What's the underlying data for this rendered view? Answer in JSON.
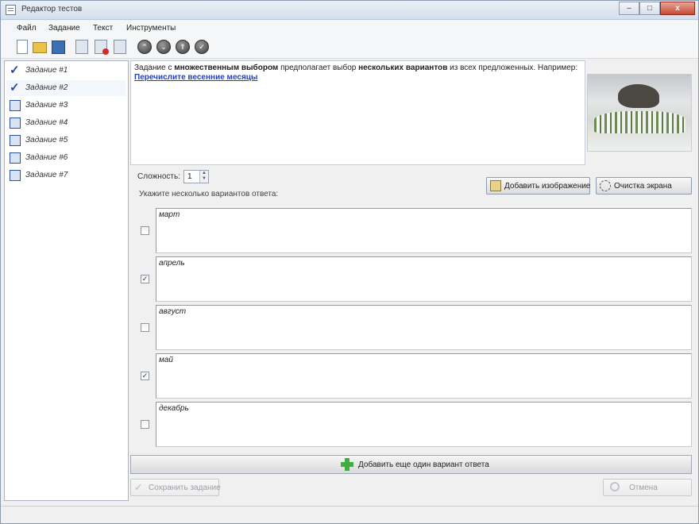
{
  "window": {
    "title": "Редактор тестов",
    "controls": {
      "minimize": "–",
      "maximize": "□",
      "close": "x"
    }
  },
  "menu": [
    "Файл",
    "Задание",
    "Текст",
    "Инструменты"
  ],
  "toolbar": {
    "icons": [
      "new-document-icon",
      "open-folder-icon",
      "save-icon",
      "add-task-icon",
      "delete-task-icon",
      "copy-task-icon",
      "move-up-icon",
      "move-down-icon",
      "move-top-icon",
      "move-bottom-icon"
    ],
    "arrow_up": "⌃",
    "arrow_down": "⌄",
    "arrow_top": "⇑",
    "arrow_check": "✓"
  },
  "tasks": [
    {
      "label": "Задание #1",
      "icon": "check-icon"
    },
    {
      "label": "Задание #2",
      "icon": "check-icon"
    },
    {
      "label": "Задание #3",
      "icon": "ordering-icon"
    },
    {
      "label": "Задание #4",
      "icon": "matching-icon"
    },
    {
      "label": "Задание #5",
      "icon": "input-icon"
    },
    {
      "label": "Задание #6",
      "icon": "text-input-icon"
    },
    {
      "label": "Задание #7",
      "icon": "area-icon"
    }
  ],
  "description": {
    "part1": "Задание с ",
    "bold1": "множественным выбором",
    "part2": " предполагает выбор ",
    "bold2": "нескольких вариантов",
    "part3": " из всех предложенных. Например:",
    "question": "Перечислите весенние месяцы"
  },
  "difficulty": {
    "label": "Сложность:",
    "value": "1"
  },
  "hint": "Укажите несколько вариантов ответа:",
  "buttons": {
    "add_image": "Добавить изображение",
    "clear_screen": "Очистка экрана",
    "add_variant": "Добавить еще один вариант ответа",
    "save_task": "Сохранить задание",
    "cancel": "Отмена"
  },
  "answers": [
    {
      "text": "март",
      "checked": false
    },
    {
      "text": "апрель",
      "checked": true
    },
    {
      "text": "август",
      "checked": false
    },
    {
      "text": "май",
      "checked": true
    },
    {
      "text": "декабрь",
      "checked": false
    }
  ],
  "check_mark": "✓"
}
